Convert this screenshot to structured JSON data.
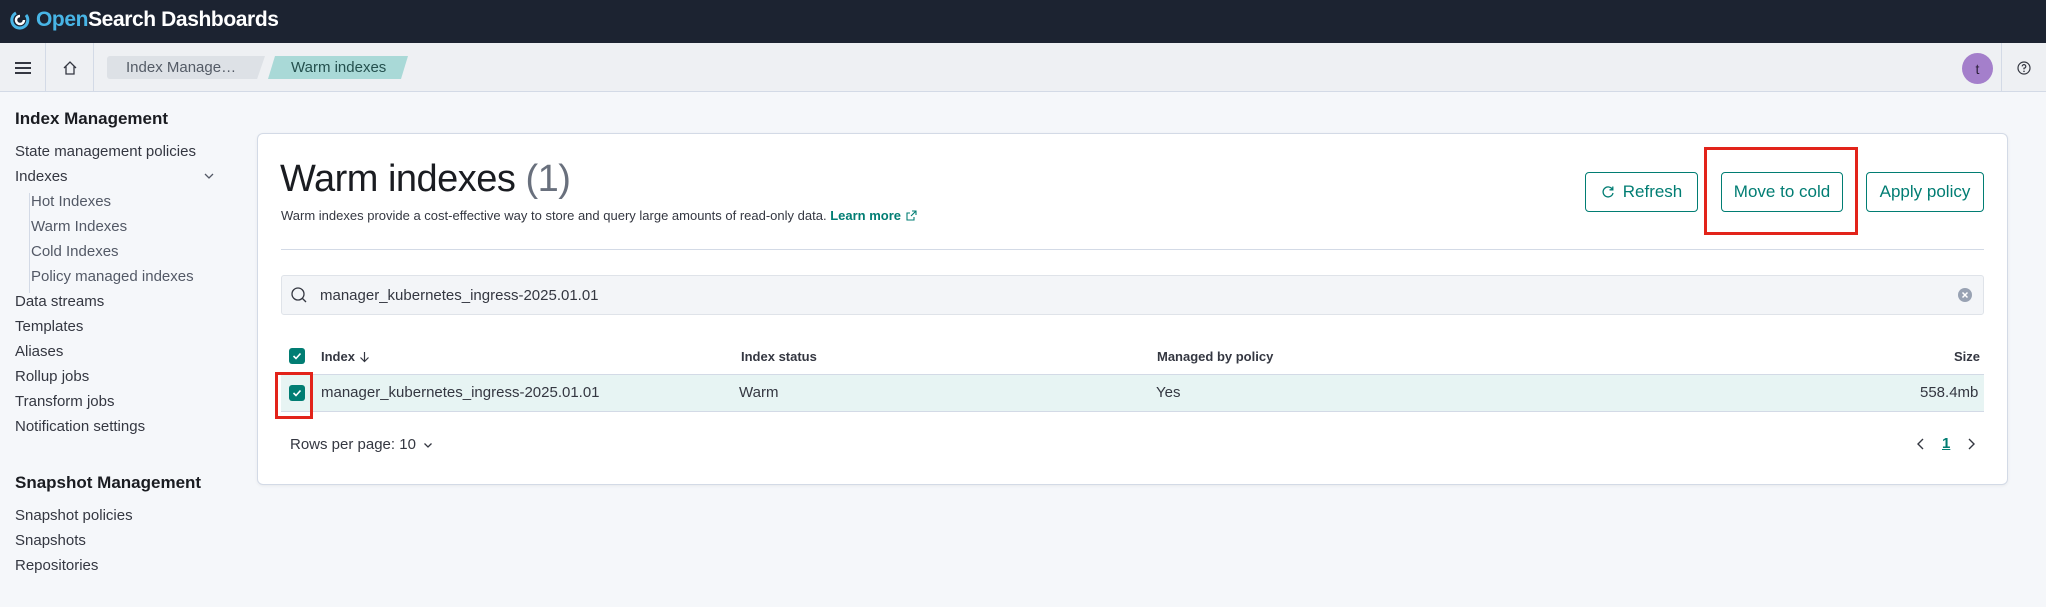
{
  "header": {
    "logo_open": "Open",
    "logo_rest": "Search Dashboards",
    "brand_color": "#48b5e6"
  },
  "navbar": {
    "breadcrumbs": [
      {
        "label": "Index Manage…"
      },
      {
        "label": "Warm indexes"
      }
    ],
    "avatar_initial": "t"
  },
  "sidebar": {
    "index_management_title": "Index Management",
    "items": [
      {
        "label": "State management policies"
      },
      {
        "label": "Indexes"
      },
      {
        "label": "Hot Indexes"
      },
      {
        "label": "Warm Indexes"
      },
      {
        "label": "Cold Indexes"
      },
      {
        "label": "Policy managed indexes"
      },
      {
        "label": "Data streams"
      },
      {
        "label": "Templates"
      },
      {
        "label": "Aliases"
      },
      {
        "label": "Rollup jobs"
      },
      {
        "label": "Transform jobs"
      },
      {
        "label": "Notification settings"
      }
    ],
    "snapshot_management_title": "Snapshot Management",
    "snapshot_items": [
      {
        "label": "Snapshot policies"
      },
      {
        "label": "Snapshots"
      },
      {
        "label": "Repositories"
      }
    ]
  },
  "main": {
    "title": "Warm indexes",
    "count": "(1)",
    "description": "Warm indexes provide a cost-effective way to store and query large amounts of read-only data.",
    "learn_more": "Learn more",
    "buttons": {
      "refresh": "Refresh",
      "move_to_cold": "Move to cold",
      "apply_policy": "Apply policy"
    },
    "search": {
      "value": "manager_kubernetes_ingress-2025.01.01"
    },
    "table": {
      "columns": [
        "Index",
        "Index status",
        "Managed by policy",
        "Size"
      ],
      "rows": [
        {
          "index": "manager_kubernetes_ingress-2025.01.01",
          "status": "Warm",
          "managed": "Yes",
          "size": "558.4mb",
          "selected": true
        }
      ]
    },
    "pagination": {
      "rows_per_page": "Rows per page: 10",
      "current_page": "1"
    },
    "accent_color": "#017d73",
    "highlight_color": "#e2231a"
  }
}
